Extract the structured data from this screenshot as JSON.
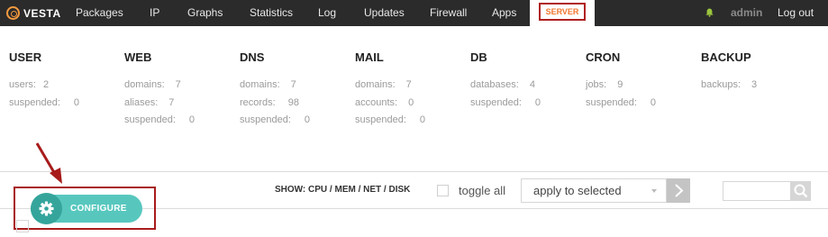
{
  "logo": {
    "text": "VESTA",
    "color": "#f79a3e"
  },
  "nav": {
    "items": [
      "Packages",
      "IP",
      "Graphs",
      "Statistics",
      "Log",
      "Updates",
      "Firewall",
      "Apps"
    ],
    "active": "SERVER",
    "active_color": "#f1762f",
    "user": "admin",
    "logout": "Log out"
  },
  "stats": [
    {
      "title": "USER",
      "rows": [
        {
          "label": "users:",
          "value": "2"
        },
        {
          "label": "suspended:",
          "value": "0"
        }
      ]
    },
    {
      "title": "WEB",
      "rows": [
        {
          "label": "domains:",
          "value": "7"
        },
        {
          "label": "aliases:",
          "value": "7"
        },
        {
          "label": "suspended:",
          "value": "0"
        }
      ]
    },
    {
      "title": "DNS",
      "rows": [
        {
          "label": "domains:",
          "value": "7"
        },
        {
          "label": "records:",
          "value": "98"
        },
        {
          "label": "suspended:",
          "value": "0"
        }
      ]
    },
    {
      "title": "MAIL",
      "rows": [
        {
          "label": "domains:",
          "value": "7"
        },
        {
          "label": "accounts:",
          "value": "0"
        },
        {
          "label": "suspended:",
          "value": "0"
        }
      ]
    },
    {
      "title": "DB",
      "rows": [
        {
          "label": "databases:",
          "value": "4"
        },
        {
          "label": "suspended:",
          "value": "0"
        }
      ]
    },
    {
      "title": "CRON",
      "rows": [
        {
          "label": "jobs:",
          "value": "9"
        },
        {
          "label": "suspended:",
          "value": "0"
        }
      ]
    },
    {
      "title": "BACKUP",
      "rows": [
        {
          "label": "backups:",
          "value": "3"
        }
      ]
    }
  ],
  "toolbar": {
    "show": "SHOW: CPU / MEM / NET / DISK",
    "toggle_all": "toggle all",
    "bulk_action": "apply to selected",
    "configure": "CONFIGURE",
    "configure_color": "#57c7be"
  },
  "icons": [
    "vesta-logo-icon",
    "bell-icon",
    "gear-icon",
    "chevron-right-icon",
    "search-icon",
    "red-arrow-icon"
  ]
}
